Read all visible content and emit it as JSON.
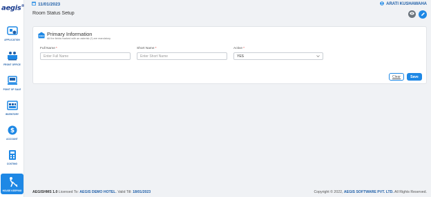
{
  "app": {
    "logo": "aegis",
    "logo_mark": "®"
  },
  "topbar": {
    "date": "11/01/2023",
    "user": "ARATI KUSHAWAHA"
  },
  "sidebar": {
    "items": [
      {
        "label": "APPLICATION",
        "icon": "application-icon"
      },
      {
        "label": "FRONT OFFICE",
        "icon": "front-office-icon"
      },
      {
        "label": "POINT OF SALE",
        "icon": "pos-icon"
      },
      {
        "label": "INVENTORY",
        "icon": "inventory-icon"
      },
      {
        "label": "ACCOUNT",
        "icon": "account-icon"
      },
      {
        "label": "COSTING",
        "icon": "costing-icon"
      },
      {
        "label": "HOUSE KEEPING",
        "icon": "house-keeping-icon",
        "active": true
      }
    ]
  },
  "page": {
    "title": "Room Status Setup"
  },
  "form": {
    "title": "Primary Information",
    "subtitle": "All the fields marked with an asterisk (*) are mandatory",
    "full_name_label": "Full Name",
    "full_name_placeholder": "Enter Full Name",
    "short_name_label": "Short Name",
    "short_name_placeholder": "Enter Short Name",
    "active_label": "Active",
    "active_value": "YES",
    "required_mark": "*",
    "clear_label": "Clear",
    "save_label": "Save"
  },
  "footer": {
    "left_prefix": "AEGISHMS 1.0",
    "licensed_to_text": "Licensed To:",
    "licensee": "AEGIS DEMO HOTEL",
    "valid_text": ". Valid Till:",
    "valid_till": "18/01/2023",
    "copyright_prefix": "Copyright © 2022,",
    "company": "AEGIS SOFTWARE PVT. LTD.",
    "rights": "All Rights Reserved."
  },
  "colors": {
    "accent": "#1e88e5",
    "brand": "#1f5fa8",
    "required": "#e53935"
  }
}
